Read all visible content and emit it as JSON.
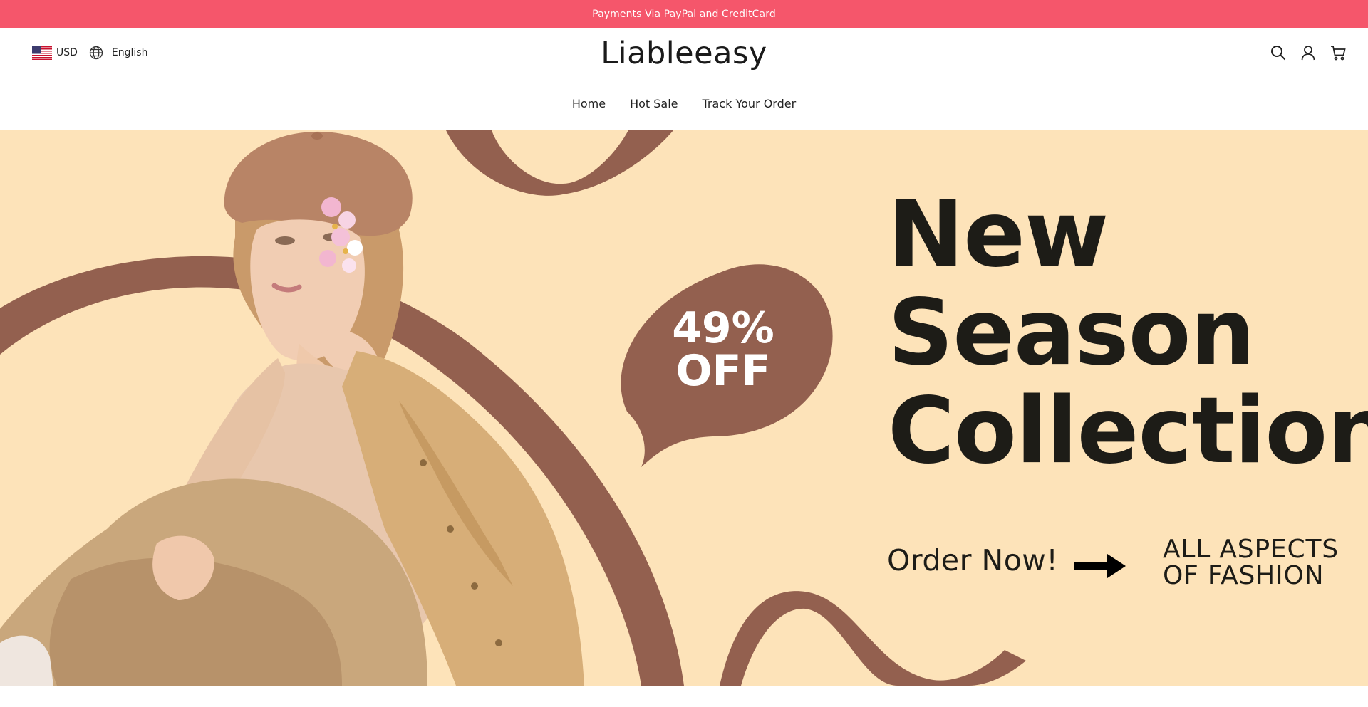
{
  "announcement": {
    "text": "Payments Via PayPal and CreditCard"
  },
  "header": {
    "currency": "USD",
    "language": "English",
    "brand": "Liableeasy",
    "icons": [
      "search-icon",
      "account-icon",
      "cart-icon"
    ]
  },
  "nav": {
    "items": [
      {
        "label": "Home"
      },
      {
        "label": "Hot Sale"
      },
      {
        "label": "Track Your Order"
      }
    ]
  },
  "hero": {
    "discount_line1": "49%",
    "discount_line2": "OFF",
    "headline_line1": "New",
    "headline_line2": "Season",
    "headline_line3": "Collection",
    "cta": "Order Now!",
    "tagline_line1": "ALL ASPECTS",
    "tagline_line2": "OF FASHION",
    "colors": {
      "background": "#fde3b9",
      "accent": "#93604f",
      "text": "#1d1c17"
    }
  },
  "colors": {
    "announcement_bg": "#f5566b",
    "announcement_text": "#ffffff"
  }
}
